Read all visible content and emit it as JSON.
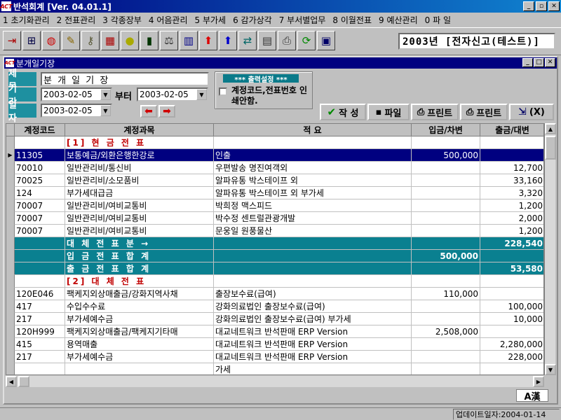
{
  "app": {
    "title": "반석회계 [Ver. 04.01.1]",
    "icon_text": "ACT"
  },
  "menu": [
    "1 초기화관리",
    "2 전표관리",
    "3 각종장부",
    "4 어음관리",
    "5 부가세",
    "6 감가상각",
    "7 부서별업무",
    "8 이월전표",
    "9 예산관리",
    "0 파 일"
  ],
  "toolbar": {
    "icons": [
      "exit-icon",
      "tree-icon",
      "globe-icon",
      "pencil-icon",
      "key-icon",
      "abacus-icon",
      "coin-icon",
      "books-icon",
      "scale-icon",
      "building-icon",
      "up-arrow-red-icon",
      "up-arrow-blue-icon",
      "transfer-icon",
      "calculator-icon",
      "printer-icon",
      "refresh-icon",
      "table-icon"
    ],
    "company": "2003년 [전자신고(테스트)]"
  },
  "child_window": {
    "title": "분개일기장"
  },
  "form": {
    "title_label": "제 목",
    "title_value": "분 개 일 기 장",
    "period_label": "기 간",
    "period_from": "2003-02-05",
    "period_sep": "부터",
    "period_to": "2003-02-05",
    "date_label": "일 자",
    "date_value": "2003-02-05"
  },
  "output": {
    "title": "*** 출력설정 ***",
    "checkbox_label": "계정코드,전표번호 인쇄안함.",
    "checked": false
  },
  "actions": {
    "write": "작 성",
    "file": "파일",
    "print1": "프린트",
    "print2": "프린트",
    "close": "(X)"
  },
  "grid": {
    "headers": [
      "계정코드",
      "계정과목",
      "적          요",
      "입금/차변",
      "출금/대변"
    ],
    "rows": [
      {
        "type": "section",
        "code": "",
        "account": "[1] 현 금 전 표",
        "desc": "",
        "debit": "",
        "credit": ""
      },
      {
        "type": "selected",
        "code": "11305",
        "account": "보통예금/외환은행한강로",
        "desc": "인출",
        "debit": "500,000",
        "credit": ""
      },
      {
        "type": "normal",
        "code": "70010",
        "account": "일반관리비/통신비",
        "desc": "우편발송   명진여객외",
        "debit": "",
        "credit": "12,700"
      },
      {
        "type": "normal",
        "code": "70025",
        "account": "일반관리비/소모품비",
        "desc": "알파유통   박스테이프 외",
        "debit": "",
        "credit": "33,160"
      },
      {
        "type": "normal",
        "code": "124",
        "account": "부가세대급금",
        "desc": "알파유통   박스테이프 외 부가세",
        "debit": "",
        "credit": "3,320"
      },
      {
        "type": "normal",
        "code": "70007",
        "account": "일반관리비/여비교통비",
        "desc": "박희정   맥스피드",
        "debit": "",
        "credit": "1,200"
      },
      {
        "type": "normal",
        "code": "70007",
        "account": "일반관리비/여비교통비",
        "desc": "박수정   센트럴관광개발",
        "debit": "",
        "credit": "2,000"
      },
      {
        "type": "normal",
        "code": "70007",
        "account": "일반관리비/여비교통비",
        "desc": "문웅일   원풍물산",
        "debit": "",
        "credit": "1,200"
      },
      {
        "type": "teal",
        "code": "",
        "account": "대 체 전 표 분 →",
        "desc": "",
        "debit": "",
        "credit": "228,540"
      },
      {
        "type": "teal",
        "code": "",
        "account": "입 금 전 표 합 계",
        "desc": "",
        "debit": "500,000",
        "credit": ""
      },
      {
        "type": "teal",
        "code": "",
        "account": "출 금 전 표 합 계",
        "desc": "",
        "debit": "",
        "credit": "53,580"
      },
      {
        "type": "section",
        "code": "",
        "account": "[2] 대 체 전 표",
        "desc": "",
        "debit": "",
        "credit": ""
      },
      {
        "type": "normal",
        "code": "120E046",
        "account": "팩케지외상매출금/강화지역사채",
        "desc": "출장보수료(급여)",
        "debit": "110,000",
        "credit": ""
      },
      {
        "type": "normal",
        "code": "417",
        "account": "수입수수료",
        "desc": "강화의료법인   출장보수료(급여)",
        "debit": "",
        "credit": "100,000"
      },
      {
        "type": "normal",
        "code": "217",
        "account": "부가세예수금",
        "desc": "강화의료법인   출장보수료(급여) 부가세",
        "debit": "",
        "credit": "10,000"
      },
      {
        "type": "normal",
        "code": "120H999",
        "account": "팩케지외상매출금/팩케지기타매",
        "desc": "대교네트워크   반석판매 ERP Version",
        "debit": "2,508,000",
        "credit": ""
      },
      {
        "type": "normal",
        "code": "415",
        "account": "용역매출",
        "desc": "대교네트워크   반석판매 ERP Version",
        "debit": "",
        "credit": "2,280,000"
      },
      {
        "type": "normal",
        "code": "217",
        "account": "부가세예수금",
        "desc": "대교네트워크   반석판매 ERP Version",
        "debit": "",
        "credit": "228,000"
      },
      {
        "type": "normal",
        "code": "",
        "account": "",
        "desc": "가세",
        "debit": "",
        "credit": ""
      }
    ]
  },
  "ime": "A漢",
  "status": {
    "update": "업데이트일자:2004-01-14"
  },
  "colors": {
    "titlebar": "#000080",
    "teal": "#0a8090",
    "section_text": "#c00000"
  }
}
